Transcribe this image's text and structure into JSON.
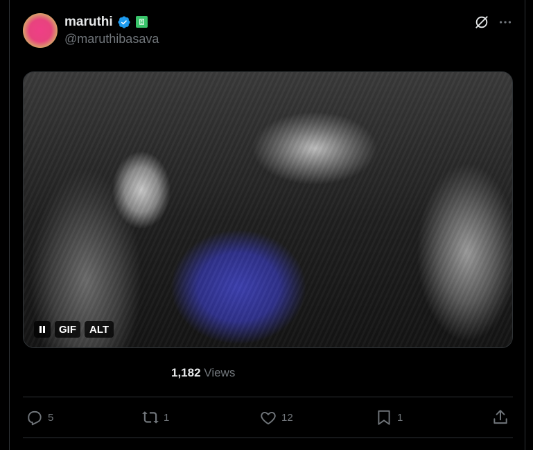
{
  "author": {
    "name": "maruthi",
    "handle": "@maruthibasava",
    "verified": true,
    "accent_color": "#1d9bf0",
    "badge_color": "#39c46a"
  },
  "media": {
    "type": "gif",
    "controls": {
      "pause_icon": "pause-icon",
      "gif_label": "GIF",
      "alt_label": "ALT"
    }
  },
  "stats": {
    "views_count": "1,182",
    "views_label": "Views"
  },
  "actions": {
    "replies": "5",
    "reposts": "1",
    "likes": "12",
    "bookmarks": "1"
  },
  "colors": {
    "background": "#000000",
    "text": "#e7e9ea",
    "muted": "#71767b",
    "border": "#2f3336"
  }
}
